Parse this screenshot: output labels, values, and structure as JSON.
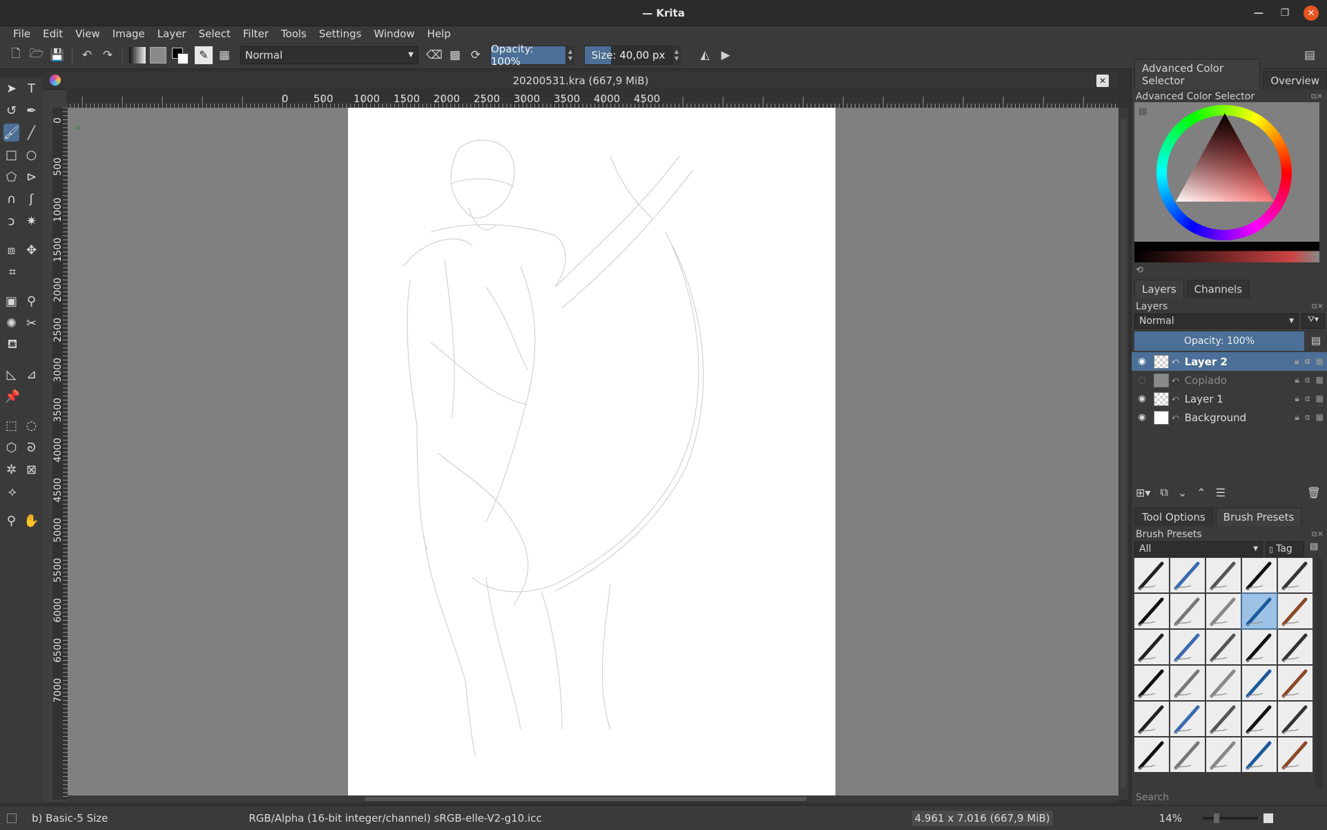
{
  "window": {
    "title": "— Krita"
  },
  "menu": [
    "File",
    "Edit",
    "View",
    "Image",
    "Layer",
    "Select",
    "Filter",
    "Tools",
    "Settings",
    "Window",
    "Help"
  ],
  "toolbar": {
    "blend_mode": "Normal",
    "opacity_label": "Opacity: 100%",
    "size_label": "Size: 40,00 px"
  },
  "document": {
    "tab_title": "20200531.kra (667,9 MiB)",
    "ruler_h": [
      "0",
      "500",
      "1000",
      "1500",
      "2000",
      "2500",
      "3000",
      "3500",
      "4000",
      "4500"
    ],
    "ruler_v": [
      "0",
      "500",
      "1000",
      "1500",
      "2000",
      "2500",
      "3000",
      "3500",
      "4000",
      "4500",
      "5000",
      "5500",
      "6000",
      "6500",
      "7000"
    ]
  },
  "color_docker": {
    "tabs": [
      "Advanced Color Selector",
      "Overview"
    ],
    "title": "Advanced Color Selector"
  },
  "layers_docker": {
    "tabs": [
      "Layers",
      "Channels"
    ],
    "title": "Layers",
    "blend_mode": "Normal",
    "opacity_label": "Opacity:  100%",
    "layers": [
      {
        "name": "Layer 2",
        "visible": true,
        "active": true,
        "thumb": "check"
      },
      {
        "name": "Copiado",
        "visible": false,
        "active": false,
        "thumb": "copy"
      },
      {
        "name": "Layer 1",
        "visible": true,
        "active": false,
        "thumb": "check"
      },
      {
        "name": "Background",
        "visible": true,
        "active": false,
        "thumb": "white"
      }
    ]
  },
  "brush_docker": {
    "tabs": [
      "Tool Options",
      "Brush Presets"
    ],
    "title": "Brush Presets",
    "filter": "All",
    "tag_label": "Tag",
    "search_placeholder": "Search",
    "selected_index": 8
  },
  "status": {
    "brush_name": "b) Basic-5 Size",
    "color_profile": "RGB/Alpha (16-bit integer/channel)  sRGB-elle-V2-g10.icc",
    "image_size": "4.961 x 7.016 (667,9 MiB)",
    "zoom": "14%"
  },
  "colors": {
    "accent": "#4b6f96",
    "close": "#e95420"
  }
}
